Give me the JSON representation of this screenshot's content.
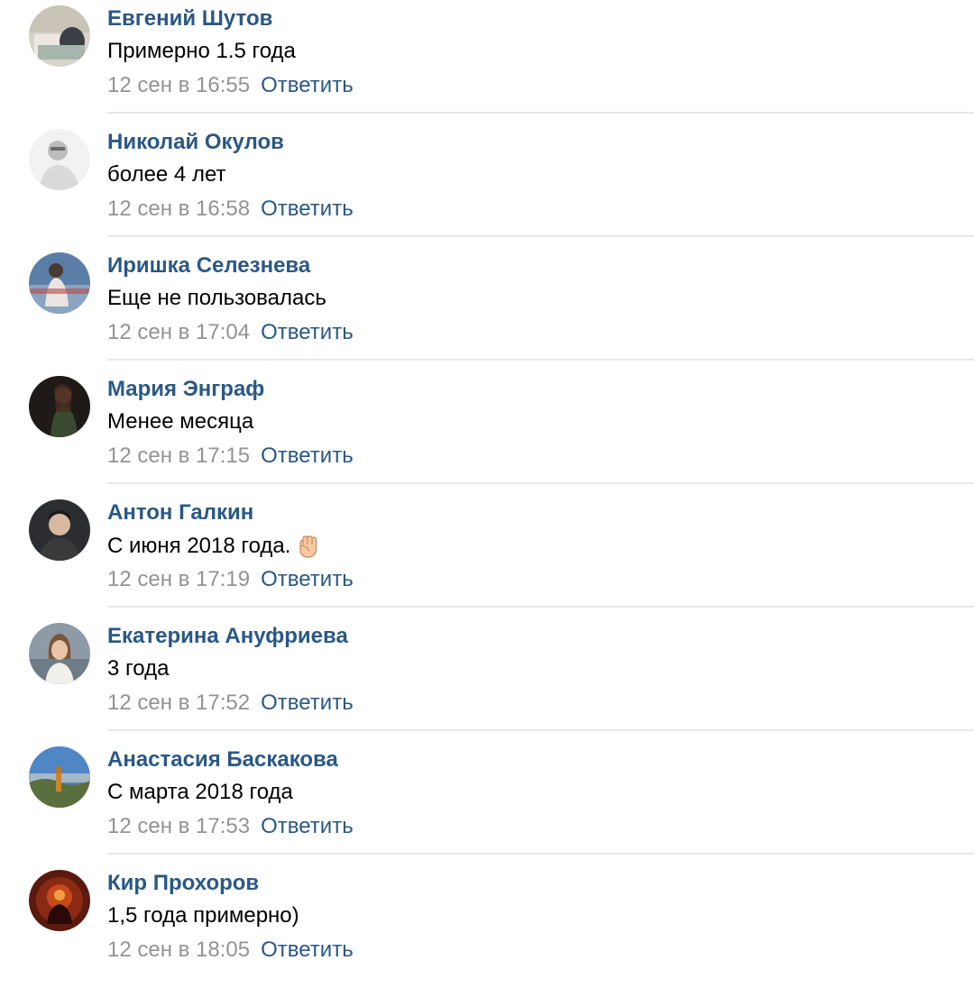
{
  "comments": [
    {
      "author": "Евгений Шутов",
      "text": "Примерно 1.5 года",
      "date": "12 сен в 16:55",
      "reply": "Ответить"
    },
    {
      "author": "Николай Окулов",
      "text": "более 4 лет",
      "date": "12 сен в 16:58",
      "reply": "Ответить"
    },
    {
      "author": "Иришка Селезнева",
      "text": "Еще не пользовалась",
      "date": "12 сен в 17:04",
      "reply": "Ответить"
    },
    {
      "author": "Мария Энграф",
      "text": "Менее месяца",
      "date": "12 сен в 17:15",
      "reply": "Ответить"
    },
    {
      "author": "Антон Галкин",
      "text": "С июня 2018 года.",
      "emoji": "raised-fist-emoji",
      "date": "12 сен в 17:19",
      "reply": "Ответить"
    },
    {
      "author": "Екатерина Ануфриева",
      "text": "3 года",
      "date": "12 сен в 17:52",
      "reply": "Ответить"
    },
    {
      "author": "Анастасия Баскакова",
      "text": "С марта 2018 года",
      "date": "12 сен в 17:53",
      "reply": "Ответить"
    },
    {
      "author": "Кир Прохоров",
      "text": "1,5 года примерно)",
      "date": "12 сен в 18:05",
      "reply": "Ответить"
    }
  ],
  "colors": {
    "link": "#2a5885",
    "date": "#939393",
    "text": "#000000",
    "divider": "#e7e8ec"
  }
}
